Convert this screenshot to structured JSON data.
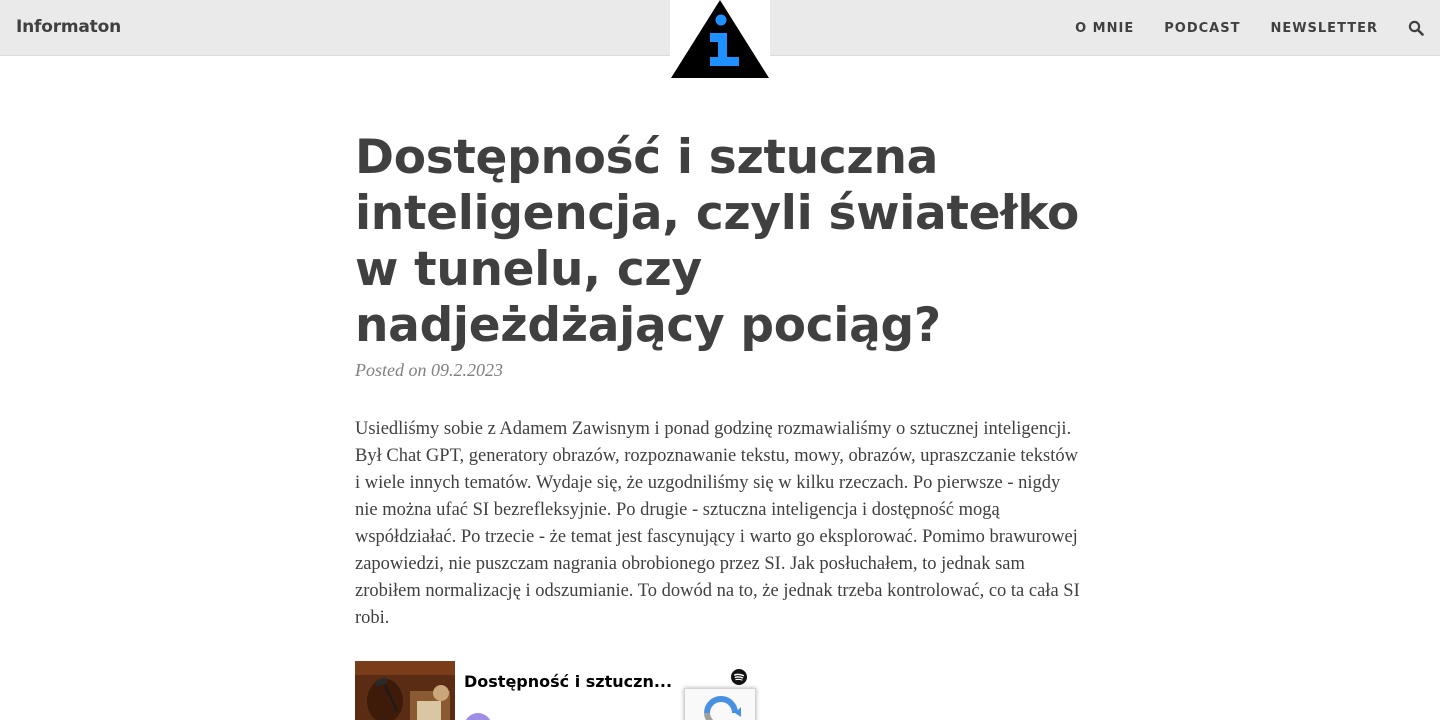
{
  "navbar": {
    "brand": "Informaton",
    "links": [
      {
        "label": "O MNIE"
      },
      {
        "label": "PODCAST"
      },
      {
        "label": "NEWSLETTER"
      }
    ],
    "search_icon": "search-icon",
    "logo_icon": "info-triangle-logo"
  },
  "article": {
    "title": "Dostępność i sztuczna inteligencja, czyli światełko w tunelu, czy nadjeżdżający pociąg?",
    "posted_on": "Posted on 09.2.2023",
    "body": "Usiedliśmy sobie z Adamem Zawisnym i ponad godzinę rozmawialiśmy o sztucznej inteligencji. Był Chat GPT, generatory obrazów, rozpoznawanie tekstu, mowy, obrazów, upraszczanie tekstów i wiele innych tematów. Wydaje się, że uzgodniliśmy się w kilku rzeczach. Po pierwsze - nigdy nie można ufać SI bezrefleksyjnie. Po drugie - sztuczna inteligencja i dostępność mogą współdziałać. Po trzecie - że temat jest fascynujący i warto go eksplorować. Pomimo brawurowej zapowiedzi, nie puszczam nagrania obrobionego przez SI. Jak posłuchałem, to jednak sam zrobiłem normalizację i odszumianie. To dowód na to, że jednak trzeba kontrolować, co ta cała SI robi."
  },
  "embed": {
    "episode_title": "Dostępność i sztuczn...",
    "provider_icon": "spotify-icon"
  },
  "colors": {
    "navbar_bg": "#eaeaea",
    "text": "#404040",
    "meta": "#808080",
    "logo_blue": "#1e90ff"
  }
}
